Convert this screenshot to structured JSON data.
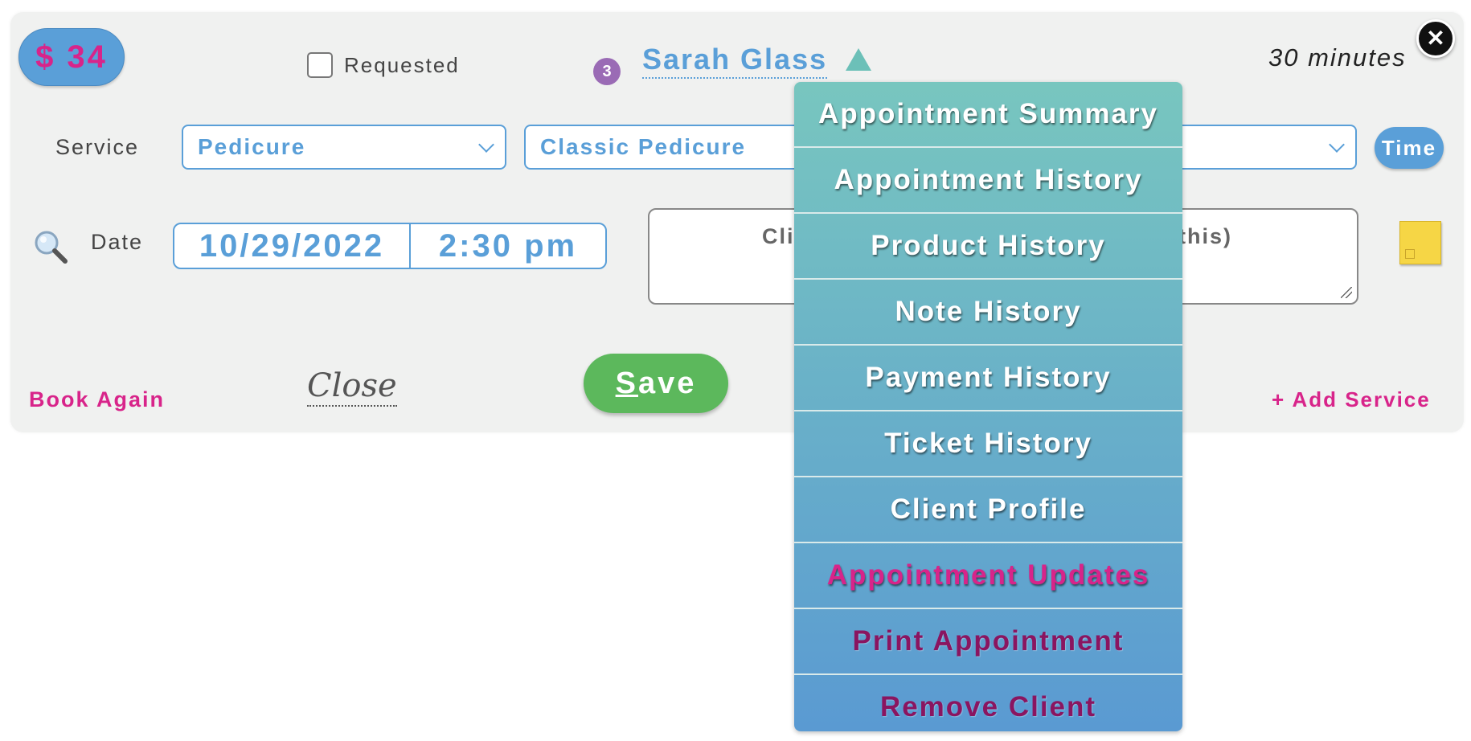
{
  "appointment": {
    "price": "$ 34",
    "requested_label": "Requested",
    "client_visits_badge": "3",
    "client_name": "Sarah Glass",
    "duration": "30 minutes",
    "close_symbol": "✕"
  },
  "service": {
    "label": "Service",
    "category": "Pedicure",
    "service_name": "Classic Pedicure",
    "time_button": "Time"
  },
  "date": {
    "label": "Date",
    "date_value": "10/29/2022",
    "time_value": "2:30 pm"
  },
  "notes": {
    "visible_text_left": "Cli",
    "visible_text_right": "this)"
  },
  "footer": {
    "book_again": "Book Again",
    "close": "Close",
    "save_first_letter": "S",
    "save_rest": "ave",
    "add_service": "+ Add Service"
  },
  "client_menu": {
    "items": [
      {
        "label": "Appointment Summary",
        "color": "#ffffff"
      },
      {
        "label": "Appointment History",
        "color": "#ffffff"
      },
      {
        "label": "Product History",
        "color": "#ffffff"
      },
      {
        "label": "Note History",
        "color": "#ffffff"
      },
      {
        "label": "Payment History",
        "color": "#ffffff"
      },
      {
        "label": "Ticket History",
        "color": "#ffffff"
      },
      {
        "label": "Client Profile",
        "color": "#ffffff"
      },
      {
        "label": "Appointment Updates",
        "color": "#d8248a"
      },
      {
        "label": "Print Appointment",
        "color": "#8a1560"
      },
      {
        "label": "Remove Client",
        "color": "#8a1560"
      }
    ]
  },
  "colors": {
    "accent_blue": "#5a9fd8",
    "accent_pink": "#d8248a",
    "save_green": "#5cb85c",
    "badge_purple": "#9a6bb5"
  },
  "icons": {
    "search": "magnifier-icon",
    "sticky": "sticky-note-icon",
    "close": "close-icon",
    "caret": "caret-up-icon"
  }
}
